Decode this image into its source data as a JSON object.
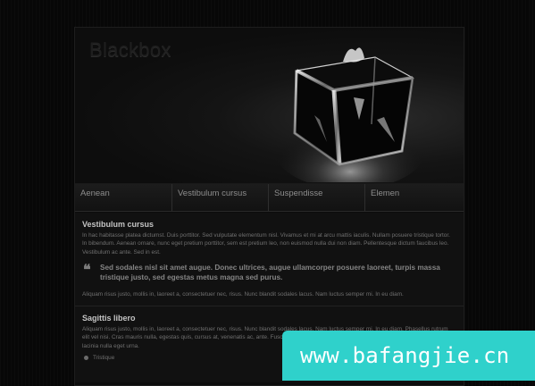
{
  "header": {
    "site_title": "Blackbox"
  },
  "nav": {
    "items": [
      "Aenean",
      "Vestibulum cursus",
      "Suspendisse",
      "Elemen"
    ]
  },
  "sections": [
    {
      "title": "Vestibulum cursus",
      "paragraph1": "In hac habitasse platea dictumst. Duis porttitor. Sed vulputate elementum nisl. Vivamus et mi at arcu mattis iaculis. Nullam posuere tristique tortor. In bibendum. Aenean ornare, nunc eget pretium porttitor, sem est pretium leo, non euismod nulla dui non diam. Pellentesque dictum faucibus leo. Vestibulum ac ante. Sed in est.",
      "quote": "Sed sodales nisl sit amet augue. Donec ultrices, augue ullamcorper posuere laoreet, turpis massa tristique justo, sed egestas metus magna sed purus.",
      "paragraph2": "Aliquam risus justo, mollis in, laoreet a, consectetuer nec, risus. Nunc blandit sodales lacus. Nam luctus semper mi. In eu diam."
    },
    {
      "title": "Sagittis libero",
      "paragraph": "Aliquam risus justo, mollis in, laoreet a, consectetuer nec, risus. Nunc blandit sodales lacus. Nam luctus semper mi. In eu diam. Phasellus rutrum elit vel nisi. Cras mauris nulla, egestas quis, cursus at, venenatis ac, ante. Fusce accumsan enim et arcu. Duis sagittis libero at lacus. Suspendisse lacinia nulla eget urna.",
      "list": [
        "Tristique"
      ]
    }
  ],
  "watermark": {
    "text": "www.bafangjie.cn",
    "color": "#2fd1cb"
  },
  "colors": {
    "page_bg": "#070707",
    "content_bg": "#111111",
    "nav_text": "#8d8d8d",
    "heading": "#c4c4c4"
  }
}
